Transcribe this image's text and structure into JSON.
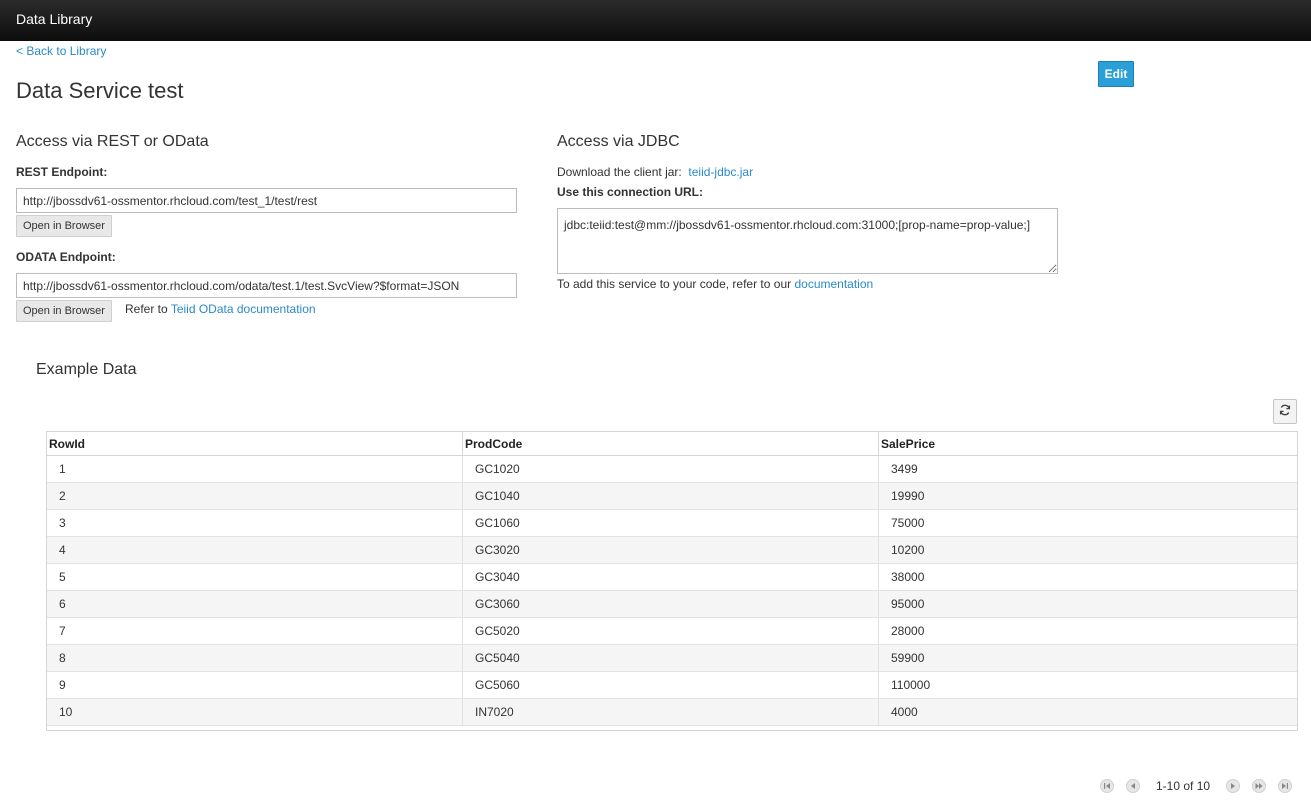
{
  "app": {
    "title": "Data Library"
  },
  "nav": {
    "back_label": "< Back to Library"
  },
  "page": {
    "title": "Data Service test",
    "edit_label": "Edit"
  },
  "rest": {
    "section_title": "Access via REST or OData",
    "rest_label": "REST Endpoint",
    "rest_value": "http://jbossdv61-ossmentor.rhcloud.com/test_1/test/rest",
    "open_label": "Open in Browser",
    "odata_label": "ODATA Endpoint",
    "odata_value": "http://jbossdv61-ossmentor.rhcloud.com/odata/test.1/test.SvcView?$format=JSON",
    "refer_prefix": "Refer to",
    "refer_link": "Teiid OData documentation"
  },
  "jdbc": {
    "section_title": "Access via JDBC",
    "download_prefix": "Download the client jar:",
    "jar_link": "teiid-jdbc.jar",
    "url_label": "Use this connection URL",
    "connection_url": "jdbc:teiid:test@mm://jbossdv61-ossmentor.rhcloud.com:31000;[prop-name=prop-value;]",
    "add_prefix": "To add this service to your code, refer to our",
    "doc_link": "documentation"
  },
  "example": {
    "title": "Example Data",
    "columns": [
      "RowId",
      "ProdCode",
      "SalePrice"
    ],
    "rows": [
      [
        "1",
        "GC1020",
        "3499"
      ],
      [
        "2",
        "GC1040",
        "19990"
      ],
      [
        "3",
        "GC1060",
        "75000"
      ],
      [
        "4",
        "GC3020",
        "10200"
      ],
      [
        "5",
        "GC3040",
        "38000"
      ],
      [
        "6",
        "GC3060",
        "95000"
      ],
      [
        "7",
        "GC5020",
        "28000"
      ],
      [
        "8",
        "GC5040",
        "59900"
      ],
      [
        "9",
        "GC5060",
        "110000"
      ],
      [
        "10",
        "IN7020",
        "4000"
      ]
    ]
  },
  "pager": {
    "range_text": "1-10 of 10"
  },
  "colors": {
    "accent": "#2a9fd8",
    "link": "#2a8ac9",
    "topbar": "#0d0d0d"
  }
}
